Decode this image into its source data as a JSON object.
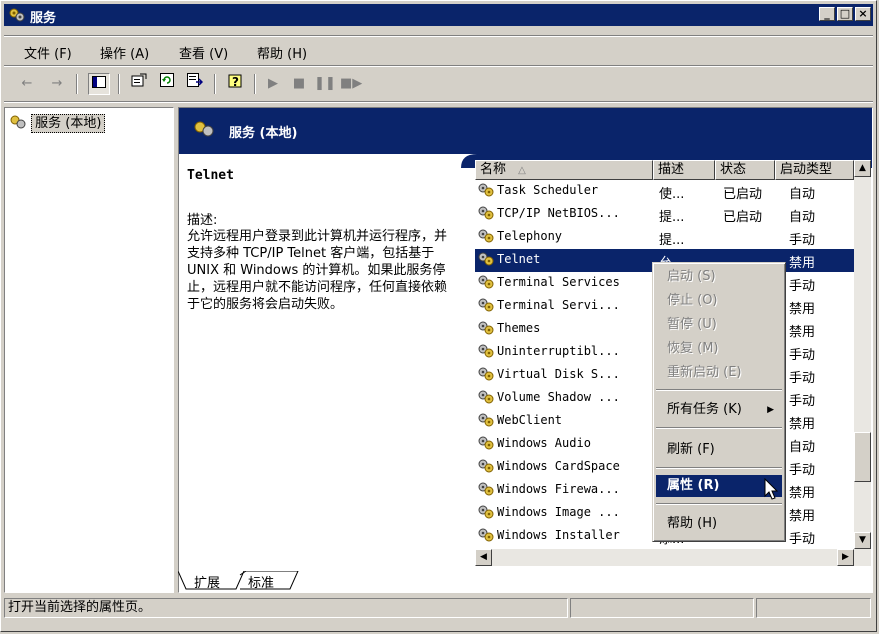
{
  "window": {
    "title": "服务"
  },
  "menu": [
    "文件 (F)",
    "操作 (A)",
    "查看 (V)",
    "帮助 (H)"
  ],
  "icons": {
    "back": "back-arrow-icon",
    "forward": "forward-arrow-icon",
    "show_tree": "show-hide-tree-icon",
    "properties": "properties-icon",
    "refresh": "refresh-icon",
    "export": "export-list-icon",
    "help": "help-icon",
    "start": "start-service-icon",
    "stop": "stop-service-icon",
    "pause": "pause-service-icon",
    "restart": "restart-service-icon"
  },
  "tree": {
    "root": "服务 (本地)"
  },
  "panel": {
    "header": "服务 (本地)",
    "service_name": "Telnet",
    "desc_label": "描述:",
    "desc_text": "允许远程用户登录到此计算机并运行程序，并支持多种 TCP/IP Telnet 客户端，包括基于 UNIX 和 Windows 的计算机。如果此服务停止，远程用户就不能访问程序，任何直接依赖于它的服务将会启动失败。"
  },
  "columns": [
    "名称",
    "描述",
    "状态",
    "启动类型"
  ],
  "rows": [
    {
      "name": "Task Scheduler",
      "desc": "使...",
      "status": "已启动",
      "startup": "自动"
    },
    {
      "name": "TCP/IP NetBIOS...",
      "desc": "提...",
      "status": "已启动",
      "startup": "自动"
    },
    {
      "name": "Telephony",
      "desc": "提...",
      "status": "",
      "startup": "手动"
    },
    {
      "name": "Telnet",
      "desc": "允...",
      "status": "",
      "startup": "禁用"
    },
    {
      "name": "Terminal Services",
      "desc": "",
      "status": "",
      "startup": "手动"
    },
    {
      "name": "Terminal Servi...",
      "desc": "",
      "status": "",
      "startup": "禁用"
    },
    {
      "name": "Themes",
      "desc": "",
      "status": "",
      "startup": "禁用"
    },
    {
      "name": "Uninterruptibl...",
      "desc": "",
      "status": "",
      "startup": "手动"
    },
    {
      "name": "Virtual Disk S...",
      "desc": "",
      "status": "",
      "startup": "手动"
    },
    {
      "name": "Volume Shadow ...",
      "desc": "",
      "status": "",
      "startup": "手动"
    },
    {
      "name": "WebClient",
      "desc": "",
      "status": "",
      "startup": "禁用"
    },
    {
      "name": "Windows Audio",
      "desc": "",
      "status": "",
      "startup": "自动"
    },
    {
      "name": "Windows CardSpace",
      "desc": "",
      "status": "",
      "startup": "手动"
    },
    {
      "name": "Windows Firewa...",
      "desc": "",
      "status": "",
      "startup": "禁用"
    },
    {
      "name": "Windows Image ...",
      "desc": "",
      "status": "",
      "startup": "禁用"
    },
    {
      "name": "Windows Installer",
      "desc": "添...",
      "status": "",
      "startup": "手动"
    }
  ],
  "context_menu": {
    "start": "启动 (S)",
    "stop": "停止 (O)",
    "pause": "暂停 (U)",
    "resume": "恢复 (M)",
    "restart": "重新启动 (E)",
    "all_tasks": "所有任务 (K)",
    "refresh": "刷新 (F)",
    "properties": "属性 (R)",
    "help": "帮助 (H)"
  },
  "tabs": {
    "extended": "扩展",
    "standard": "标准"
  },
  "status": {
    "text": "打开当前选择的属性页。"
  }
}
